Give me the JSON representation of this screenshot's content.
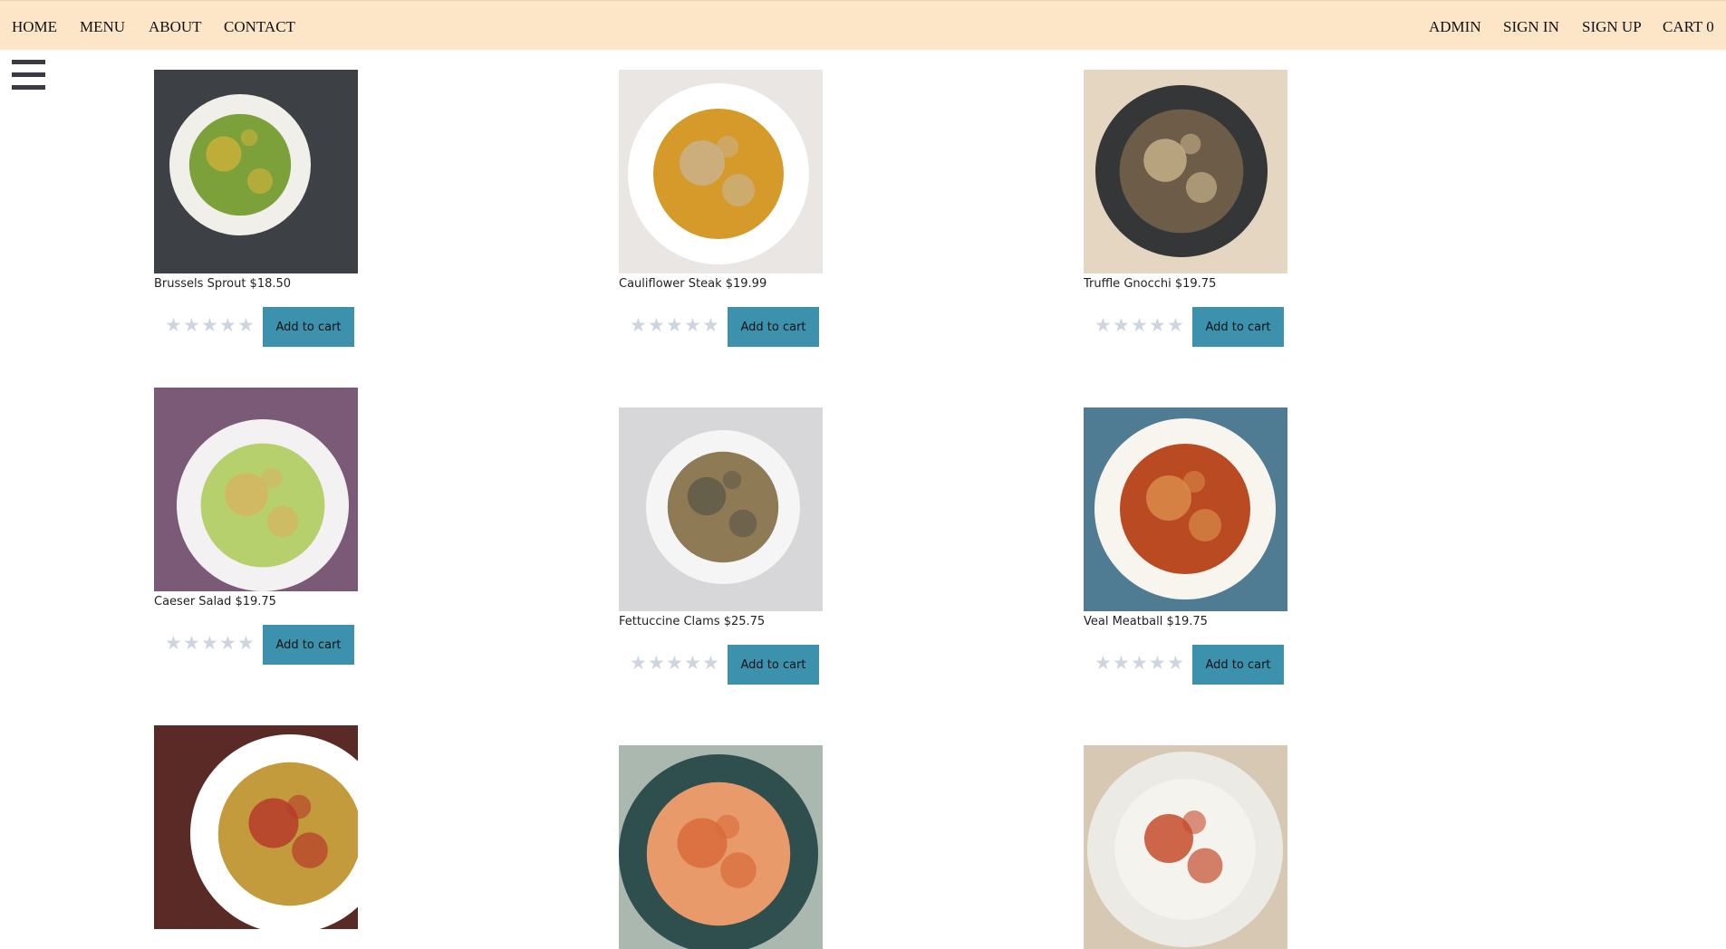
{
  "nav": {
    "home": "HOME",
    "menu": "MENU",
    "about": "ABOUT",
    "contact": "CONTACT",
    "admin": "ADMIN",
    "sign_in": "SIGN IN",
    "sign_up": "SIGN UP",
    "cart": "CART 0"
  },
  "colors": {
    "nav_bg": "#fde5c7",
    "button_bg": "#3c92ad",
    "star_empty": "#cfd5de"
  },
  "rating_max": 5,
  "add_to_cart_label": "Add to cart",
  "items": [
    {
      "caption": "Brussels Sprout $18.50",
      "rating": 0
    },
    {
      "caption": "Cauliflower Steak $19.99",
      "rating": 0
    },
    {
      "caption": "Truffle Gnocchi $19.75",
      "rating": 0
    },
    {
      "caption": "Caeser Salad $19.75",
      "rating": 0
    },
    {
      "caption": "Fettuccine Clams $25.75",
      "rating": 0
    },
    {
      "caption": "Veal Meatball $19.75",
      "rating": 0
    },
    {
      "caption": "",
      "rating": 0
    },
    {
      "caption": "",
      "rating": 0
    },
    {
      "caption": "",
      "rating": 0
    }
  ]
}
